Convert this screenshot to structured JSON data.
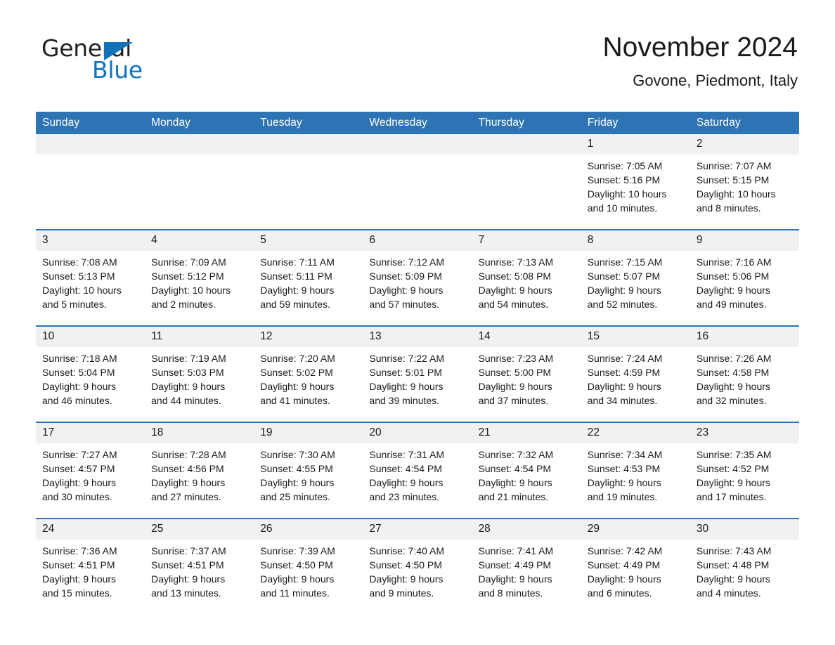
{
  "logo": {
    "part1": "General",
    "part2": "Blue",
    "triangle_color": "#1173ba"
  },
  "header": {
    "month_title": "November 2024",
    "location": "Govone, Piedmont, Italy"
  },
  "theme": {
    "header_blue": "#2e74b5",
    "daynum_band": "#f1f1f1",
    "text": "#1a1a1a",
    "page_background": "#ffffff"
  },
  "weekday_headers": [
    "Sunday",
    "Monday",
    "Tuesday",
    "Wednesday",
    "Thursday",
    "Friday",
    "Saturday"
  ],
  "labels": {
    "sunrise_prefix": "Sunrise:",
    "sunset_prefix": "Sunset:",
    "daylight_prefix": "Daylight:"
  },
  "weeks": [
    [
      {
        "empty": true
      },
      {
        "empty": true
      },
      {
        "empty": true
      },
      {
        "empty": true
      },
      {
        "empty": true
      },
      {
        "day": "1",
        "sunrise": "Sunrise: 7:05 AM",
        "sunset": "Sunset: 5:16 PM",
        "daylight1": "Daylight: 10 hours",
        "daylight2": "and 10 minutes."
      },
      {
        "day": "2",
        "sunrise": "Sunrise: 7:07 AM",
        "sunset": "Sunset: 5:15 PM",
        "daylight1": "Daylight: 10 hours",
        "daylight2": "and 8 minutes."
      }
    ],
    [
      {
        "day": "3",
        "sunrise": "Sunrise: 7:08 AM",
        "sunset": "Sunset: 5:13 PM",
        "daylight1": "Daylight: 10 hours",
        "daylight2": "and 5 minutes."
      },
      {
        "day": "4",
        "sunrise": "Sunrise: 7:09 AM",
        "sunset": "Sunset: 5:12 PM",
        "daylight1": "Daylight: 10 hours",
        "daylight2": "and 2 minutes."
      },
      {
        "day": "5",
        "sunrise": "Sunrise: 7:11 AM",
        "sunset": "Sunset: 5:11 PM",
        "daylight1": "Daylight: 9 hours",
        "daylight2": "and 59 minutes."
      },
      {
        "day": "6",
        "sunrise": "Sunrise: 7:12 AM",
        "sunset": "Sunset: 5:09 PM",
        "daylight1": "Daylight: 9 hours",
        "daylight2": "and 57 minutes."
      },
      {
        "day": "7",
        "sunrise": "Sunrise: 7:13 AM",
        "sunset": "Sunset: 5:08 PM",
        "daylight1": "Daylight: 9 hours",
        "daylight2": "and 54 minutes."
      },
      {
        "day": "8",
        "sunrise": "Sunrise: 7:15 AM",
        "sunset": "Sunset: 5:07 PM",
        "daylight1": "Daylight: 9 hours",
        "daylight2": "and 52 minutes."
      },
      {
        "day": "9",
        "sunrise": "Sunrise: 7:16 AM",
        "sunset": "Sunset: 5:06 PM",
        "daylight1": "Daylight: 9 hours",
        "daylight2": "and 49 minutes."
      }
    ],
    [
      {
        "day": "10",
        "sunrise": "Sunrise: 7:18 AM",
        "sunset": "Sunset: 5:04 PM",
        "daylight1": "Daylight: 9 hours",
        "daylight2": "and 46 minutes."
      },
      {
        "day": "11",
        "sunrise": "Sunrise: 7:19 AM",
        "sunset": "Sunset: 5:03 PM",
        "daylight1": "Daylight: 9 hours",
        "daylight2": "and 44 minutes."
      },
      {
        "day": "12",
        "sunrise": "Sunrise: 7:20 AM",
        "sunset": "Sunset: 5:02 PM",
        "daylight1": "Daylight: 9 hours",
        "daylight2": "and 41 minutes."
      },
      {
        "day": "13",
        "sunrise": "Sunrise: 7:22 AM",
        "sunset": "Sunset: 5:01 PM",
        "daylight1": "Daylight: 9 hours",
        "daylight2": "and 39 minutes."
      },
      {
        "day": "14",
        "sunrise": "Sunrise: 7:23 AM",
        "sunset": "Sunset: 5:00 PM",
        "daylight1": "Daylight: 9 hours",
        "daylight2": "and 37 minutes."
      },
      {
        "day": "15",
        "sunrise": "Sunrise: 7:24 AM",
        "sunset": "Sunset: 4:59 PM",
        "daylight1": "Daylight: 9 hours",
        "daylight2": "and 34 minutes."
      },
      {
        "day": "16",
        "sunrise": "Sunrise: 7:26 AM",
        "sunset": "Sunset: 4:58 PM",
        "daylight1": "Daylight: 9 hours",
        "daylight2": "and 32 minutes."
      }
    ],
    [
      {
        "day": "17",
        "sunrise": "Sunrise: 7:27 AM",
        "sunset": "Sunset: 4:57 PM",
        "daylight1": "Daylight: 9 hours",
        "daylight2": "and 30 minutes."
      },
      {
        "day": "18",
        "sunrise": "Sunrise: 7:28 AM",
        "sunset": "Sunset: 4:56 PM",
        "daylight1": "Daylight: 9 hours",
        "daylight2": "and 27 minutes."
      },
      {
        "day": "19",
        "sunrise": "Sunrise: 7:30 AM",
        "sunset": "Sunset: 4:55 PM",
        "daylight1": "Daylight: 9 hours",
        "daylight2": "and 25 minutes."
      },
      {
        "day": "20",
        "sunrise": "Sunrise: 7:31 AM",
        "sunset": "Sunset: 4:54 PM",
        "daylight1": "Daylight: 9 hours",
        "daylight2": "and 23 minutes."
      },
      {
        "day": "21",
        "sunrise": "Sunrise: 7:32 AM",
        "sunset": "Sunset: 4:54 PM",
        "daylight1": "Daylight: 9 hours",
        "daylight2": "and 21 minutes."
      },
      {
        "day": "22",
        "sunrise": "Sunrise: 7:34 AM",
        "sunset": "Sunset: 4:53 PM",
        "daylight1": "Daylight: 9 hours",
        "daylight2": "and 19 minutes."
      },
      {
        "day": "23",
        "sunrise": "Sunrise: 7:35 AM",
        "sunset": "Sunset: 4:52 PM",
        "daylight1": "Daylight: 9 hours",
        "daylight2": "and 17 minutes."
      }
    ],
    [
      {
        "day": "24",
        "sunrise": "Sunrise: 7:36 AM",
        "sunset": "Sunset: 4:51 PM",
        "daylight1": "Daylight: 9 hours",
        "daylight2": "and 15 minutes."
      },
      {
        "day": "25",
        "sunrise": "Sunrise: 7:37 AM",
        "sunset": "Sunset: 4:51 PM",
        "daylight1": "Daylight: 9 hours",
        "daylight2": "and 13 minutes."
      },
      {
        "day": "26",
        "sunrise": "Sunrise: 7:39 AM",
        "sunset": "Sunset: 4:50 PM",
        "daylight1": "Daylight: 9 hours",
        "daylight2": "and 11 minutes."
      },
      {
        "day": "27",
        "sunrise": "Sunrise: 7:40 AM",
        "sunset": "Sunset: 4:50 PM",
        "daylight1": "Daylight: 9 hours",
        "daylight2": "and 9 minutes."
      },
      {
        "day": "28",
        "sunrise": "Sunrise: 7:41 AM",
        "sunset": "Sunset: 4:49 PM",
        "daylight1": "Daylight: 9 hours",
        "daylight2": "and 8 minutes."
      },
      {
        "day": "29",
        "sunrise": "Sunrise: 7:42 AM",
        "sunset": "Sunset: 4:49 PM",
        "daylight1": "Daylight: 9 hours",
        "daylight2": "and 6 minutes."
      },
      {
        "day": "30",
        "sunrise": "Sunrise: 7:43 AM",
        "sunset": "Sunset: 4:48 PM",
        "daylight1": "Daylight: 9 hours",
        "daylight2": "and 4 minutes."
      }
    ]
  ]
}
